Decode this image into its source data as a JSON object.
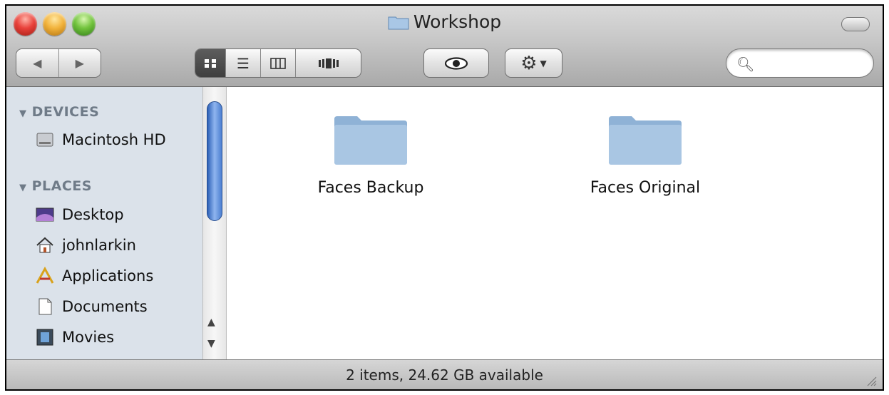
{
  "window": {
    "title": "Workshop"
  },
  "toolbar": {
    "back_icon": "left-triangle-icon",
    "forward_icon": "right-triangle-icon",
    "view_modes": [
      "icon-view",
      "list-view",
      "column-view",
      "cover-flow-view"
    ],
    "active_view": "icon-view",
    "quicklook_icon": "eye-icon",
    "action_icon": "gear-icon",
    "search": {
      "value": "",
      "placeholder": ""
    }
  },
  "sidebar": {
    "sections": [
      {
        "heading": "DEVICES",
        "items": [
          {
            "label": "Macintosh HD",
            "icon": "hard-drive-icon"
          }
        ]
      },
      {
        "heading": "PLACES",
        "items": [
          {
            "label": "Desktop",
            "icon": "desktop-icon"
          },
          {
            "label": "johnlarkin",
            "icon": "home-icon"
          },
          {
            "label": "Applications",
            "icon": "applications-icon"
          },
          {
            "label": "Documents",
            "icon": "documents-icon"
          },
          {
            "label": "Movies",
            "icon": "movies-icon"
          }
        ]
      }
    ]
  },
  "content": {
    "items": [
      {
        "name": "Faces Backup",
        "icon": "folder-icon"
      },
      {
        "name": "Faces Original",
        "icon": "folder-icon"
      }
    ]
  },
  "status": {
    "text": "2 items, 24.62 GB available"
  },
  "colors": {
    "sidebar_bg": "#dbe2ea",
    "folder_blue": "#8fb2d6",
    "scroll_thumb": "#4c7fd0"
  }
}
